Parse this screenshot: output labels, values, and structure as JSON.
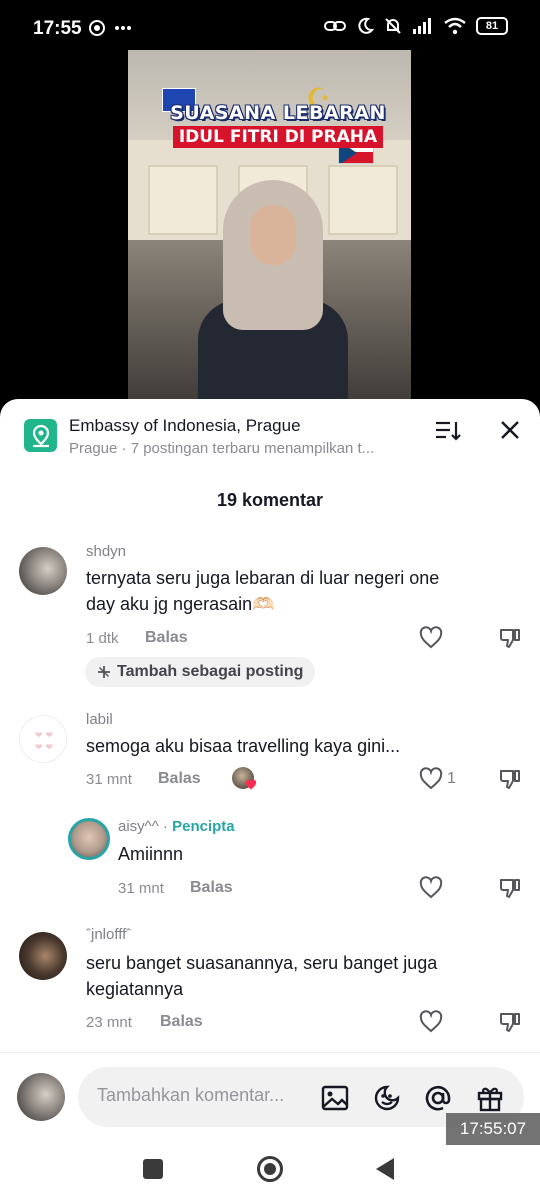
{
  "status_bar": {
    "time": "17:55",
    "battery": "81",
    "left_icons": [
      "tiktok-notify-icon",
      "more-dots-icon"
    ],
    "right_icons": [
      "link-icon",
      "moon-icon",
      "bell-off-icon",
      "signal-icon",
      "wifi-icon",
      "battery-icon"
    ]
  },
  "video": {
    "overlay_title_line1": "SUASANA LEBARAN",
    "overlay_title_line2": "IDUL FITRI DI PRAHA"
  },
  "header": {
    "place_name": "Embassy of Indonesia, Prague",
    "place_subtitle": "Prague · 7 postingan terbaru menampilkan t...",
    "sort_icon": "sort-icon",
    "close_icon": "close-icon"
  },
  "comments_count_label": "19 komentar",
  "comments": [
    {
      "username": "shdyn",
      "text_line1": "ternyata seru juga lebaran di luar negeri one",
      "text_line2": "day aku jg ngerasain🫶🏻",
      "time": "1 dtk",
      "reply_label": "Balas",
      "chip_label": "Tambah sebagai posting"
    },
    {
      "username": "labil",
      "text_line1": "semoga aku bisaa travelling kaya gini...",
      "time": "31 mnt",
      "reply_label": "Balas",
      "like_count": "1"
    },
    {
      "username": "aisy^^",
      "creator_tag": "Pencipta",
      "separator": " · ",
      "text_line1": "Amiinnn",
      "time": "31 mnt",
      "reply_label": "Balas"
    },
    {
      "username": "ˆjnlofffˆ",
      "text_line1": "seru banget suasanannya, seru banget juga",
      "text_line2": "kegiatannya",
      "time": "23 mnt",
      "reply_label": "Balas"
    }
  ],
  "input": {
    "placeholder": "Tambahkan komentar...",
    "icons": [
      "image-icon",
      "emoji-icon",
      "mention-icon",
      "gift-icon"
    ]
  },
  "timestamp_overlay": "17:55:07",
  "colors": {
    "brand_teal": "#26a4a6",
    "location_green": "#1fb68b",
    "background": "#ffffff"
  }
}
